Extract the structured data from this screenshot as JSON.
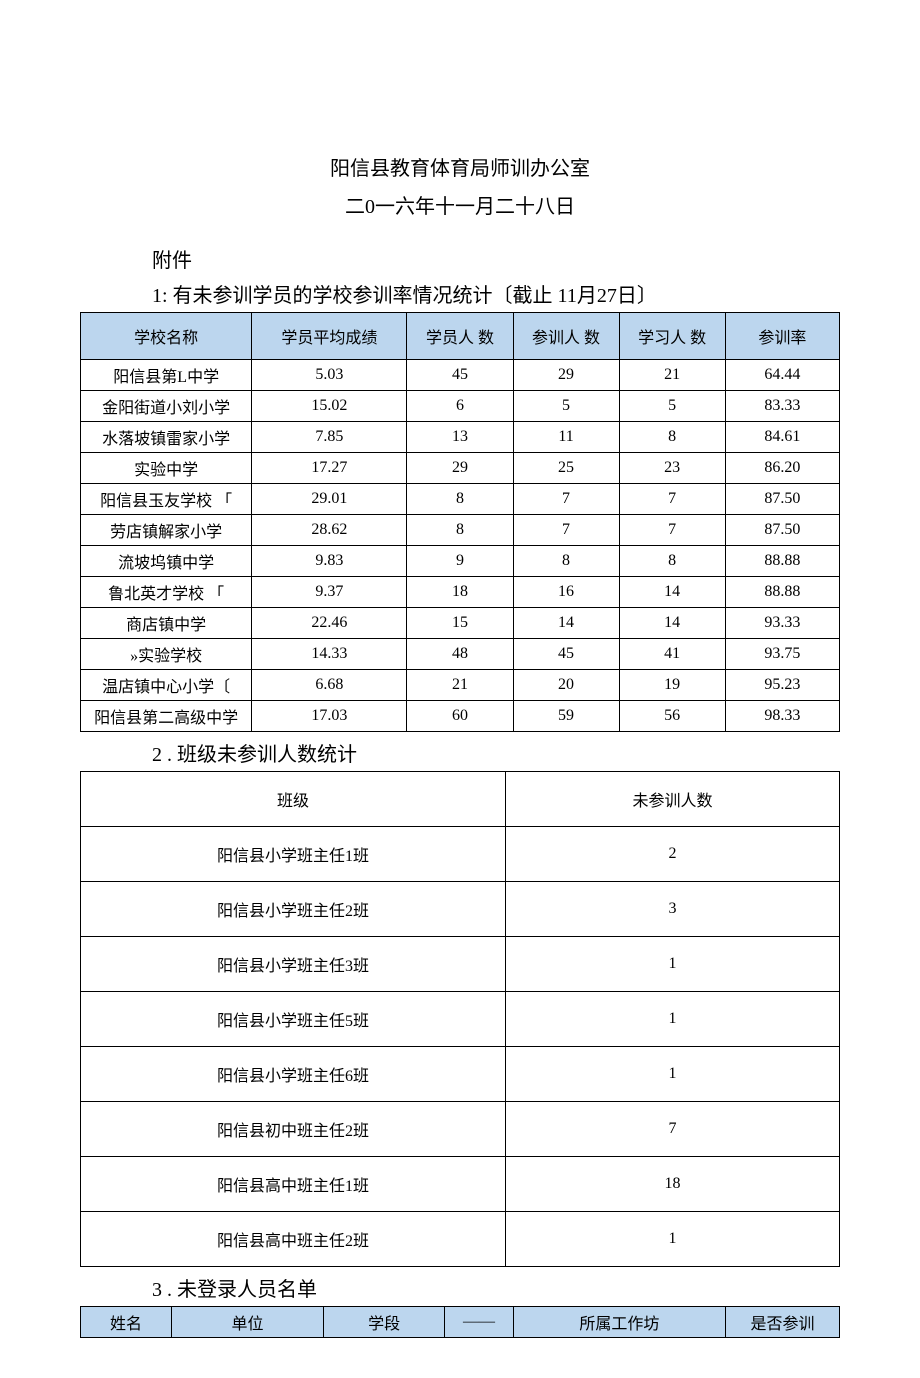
{
  "header": {
    "line1": "阳信县教育体育局师训办公室",
    "line2": "二0一六年十一月二十八日"
  },
  "attachment_label": "附件",
  "section1": {
    "title": "1: 有未参训学员的学校参训率情况统计〔截止 11月27日〕",
    "columns": {
      "school": "学校名称",
      "avg": "学员平均成绩",
      "total": "学员人  数",
      "train": "参训人  数",
      "study": "学习人  数",
      "rate": "参训率"
    },
    "rows": [
      {
        "school": "阳信县第L中学",
        "avg": "5.03",
        "total": "45",
        "train": "29",
        "study": "21",
        "rate": "64.44"
      },
      {
        "school": "金阳街道小刘小学",
        "avg": "15.02",
        "total": "6",
        "train": "5",
        "study": "5",
        "rate": "83.33"
      },
      {
        "school": "水落坡镇雷家小学",
        "avg": "7.85",
        "total": "13",
        "train": "11",
        "study": "8",
        "rate": "84.61"
      },
      {
        "school": "实验中学",
        "avg": "17.27",
        "total": "29",
        "train": "25",
        "study": "23",
        "rate": "86.20"
      },
      {
        "school": "阳信县玉友学校 「",
        "avg": "29.01",
        "total": "8",
        "train": "7",
        "study": "7",
        "rate": "87.50"
      },
      {
        "school": "劳店镇解家小学",
        "avg": "28.62",
        "total": "8",
        "train": "7",
        "study": "7",
        "rate": "87.50"
      },
      {
        "school": "流坡坞镇中学",
        "avg": "9.83",
        "total": "9",
        "train": "8",
        "study": "8",
        "rate": "88.88"
      },
      {
        "school": "鲁北英才学校 「",
        "avg": "9.37",
        "total": "18",
        "train": "16",
        "study": "14",
        "rate": "88.88"
      },
      {
        "school": "商店镇中学",
        "avg": "22.46",
        "total": "15",
        "train": "14",
        "study": "14",
        "rate": "93.33"
      },
      {
        "school": "»实验学校",
        "avg": "14.33",
        "total": "48",
        "train": "45",
        "study": "41",
        "rate": "93.75"
      },
      {
        "school": "温店镇中心小学〔",
        "avg": "6.68",
        "total": "21",
        "train": "20",
        "study": "19",
        "rate": "95.23"
      },
      {
        "school": "阳信县第二高级中学",
        "avg": "17.03",
        "total": "60",
        "train": "59",
        "study": "56",
        "rate": "98.33"
      }
    ]
  },
  "section2": {
    "title": "2 . 班级未参训人数统计",
    "columns": {
      "cls": "班级",
      "count": "未参训人数"
    },
    "rows": [
      {
        "cls": "阳信县小学班主任1班",
        "count": "2"
      },
      {
        "cls": "阳信县小学班主任2班",
        "count": "3"
      },
      {
        "cls": "阳信县小学班主任3班",
        "count": "1"
      },
      {
        "cls": "阳信县小学班主任5班",
        "count": "1"
      },
      {
        "cls": "阳信县小学班主任6班",
        "count": "1"
      },
      {
        "cls": "阳信县初中班主任2班",
        "count": "7"
      },
      {
        "cls": "阳信县高中班主任1班",
        "count": "18"
      },
      {
        "cls": "阳信县高中班主任2班",
        "count": "1"
      }
    ]
  },
  "section3": {
    "title": "3 . 未登录人员名单",
    "columns": {
      "name": "姓名",
      "unit": "单位",
      "stage": "学段",
      "blank": "——",
      "workshop": "所属工作坊",
      "joined": "是否参训"
    }
  },
  "chart_data": [
    {
      "type": "table",
      "title": "有未参训学员的学校参训率情况统计〔截止 11月27日〕",
      "columns": [
        "学校名称",
        "学员平均成绩",
        "学员人数",
        "参训人数",
        "学习人数",
        "参训率"
      ],
      "rows": [
        [
          "阳信县第L中学",
          5.03,
          45,
          29,
          21,
          64.44
        ],
        [
          "金阳街道小刘小学",
          15.02,
          6,
          5,
          5,
          83.33
        ],
        [
          "水落坡镇雷家小学",
          7.85,
          13,
          11,
          8,
          84.61
        ],
        [
          "实验中学",
          17.27,
          29,
          25,
          23,
          86.2
        ],
        [
          "阳信县玉友学校",
          29.01,
          8,
          7,
          7,
          87.5
        ],
        [
          "劳店镇解家小学",
          28.62,
          8,
          7,
          7,
          87.5
        ],
        [
          "流坡坞镇中学",
          9.83,
          9,
          8,
          8,
          88.88
        ],
        [
          "鲁北英才学校",
          9.37,
          18,
          16,
          14,
          88.88
        ],
        [
          "商店镇中学",
          22.46,
          15,
          14,
          14,
          93.33
        ],
        [
          "»实验学校",
          14.33,
          48,
          45,
          41,
          93.75
        ],
        [
          "温店镇中心小学",
          6.68,
          21,
          20,
          19,
          95.23
        ],
        [
          "阳信县第二高级中学",
          17.03,
          60,
          59,
          56,
          98.33
        ]
      ]
    },
    {
      "type": "table",
      "title": "班级未参训人数统计",
      "columns": [
        "班级",
        "未参训人数"
      ],
      "rows": [
        [
          "阳信县小学班主任1班",
          2
        ],
        [
          "阳信县小学班主任2班",
          3
        ],
        [
          "阳信县小学班主任3班",
          1
        ],
        [
          "阳信县小学班主任5班",
          1
        ],
        [
          "阳信县小学班主任6班",
          1
        ],
        [
          "阳信县初中班主任2班",
          7
        ],
        [
          "阳信县高中班主任1班",
          18
        ],
        [
          "阳信县高中班主任2班",
          1
        ]
      ]
    }
  ]
}
